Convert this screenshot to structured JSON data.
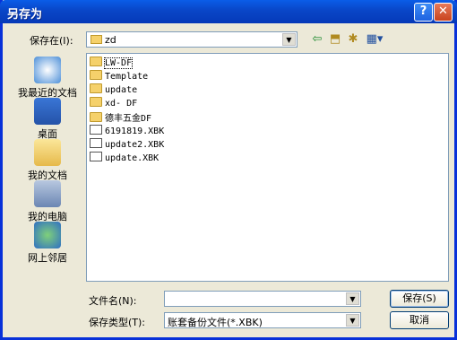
{
  "window": {
    "title": "另存为"
  },
  "titlebar": {
    "help": "?",
    "close": "✕"
  },
  "lookin": {
    "label": "保存在(I):",
    "value": "zd"
  },
  "places": [
    {
      "label": "我最近的文档",
      "icon": "recent-documents-icon"
    },
    {
      "label": "桌面",
      "icon": "desktop-icon"
    },
    {
      "label": "我的文档",
      "icon": "my-documents-icon"
    },
    {
      "label": "我的电脑",
      "icon": "my-computer-icon"
    },
    {
      "label": "网上邻居",
      "icon": "network-places-icon"
    }
  ],
  "files": [
    {
      "name": "LW-DF",
      "type": "folder"
    },
    {
      "name": "Template",
      "type": "folder"
    },
    {
      "name": "update",
      "type": "folder"
    },
    {
      "name": "xd- DF",
      "type": "folder"
    },
    {
      "name": "德丰五金DF",
      "type": "folder"
    },
    {
      "name": "6191819.XBK",
      "type": "file"
    },
    {
      "name": "update2.XBK",
      "type": "file"
    },
    {
      "name": "update.XBK",
      "type": "file"
    }
  ],
  "filename": {
    "label": "文件名(N):",
    "value": ""
  },
  "filetype": {
    "label": "保存类型(T):",
    "value": "账套备份文件(*.XBK)"
  },
  "buttons": {
    "save": "保存(S)",
    "cancel": "取消"
  }
}
